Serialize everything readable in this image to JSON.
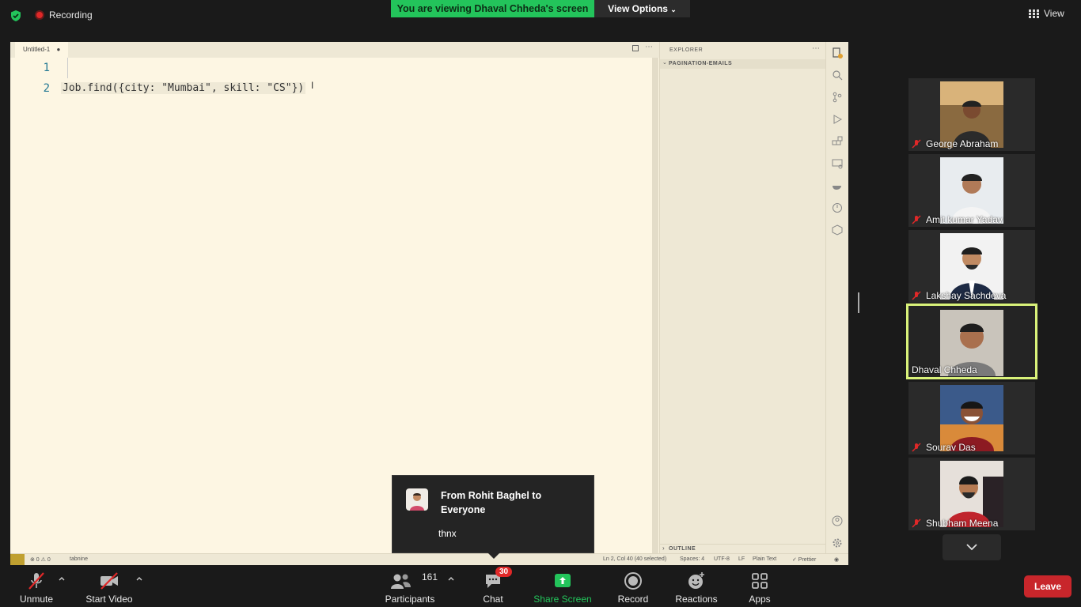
{
  "topbar": {
    "recording_label": "Recording",
    "viewing_banner": "You are viewing Dhaval Chheda's screen",
    "view_options_label": "View Options",
    "view_label": "View"
  },
  "shared_screen": {
    "tab_title": "Untitled-1",
    "line_numbers": [
      "1",
      "2"
    ],
    "code_line_2": "Job.find({city: \"Mumbai\", skill: \"CS\"})",
    "explorer_title": "EXPLORER",
    "folder_name": "PAGINATION-EMAILS",
    "outline_title": "OUTLINE",
    "status": {
      "errors": "⊗ 0 ⚠ 0",
      "tabnine": "tabnine",
      "position": "Ln 2, Col 40 (40 selected)",
      "spaces": "Spaces: 4",
      "encoding": "UTF-8",
      "eol": "LF",
      "language": "Plain Text",
      "formatter": "✓ Prettier"
    }
  },
  "chat_popup": {
    "from": "From Rohit Baghel to Everyone",
    "message": "thnx"
  },
  "participants_gallery": [
    {
      "name": "George Abraham",
      "muted": true
    },
    {
      "name": "Amit kumar Yadav",
      "muted": true
    },
    {
      "name": "Lakshay Sachdeva",
      "muted": true
    },
    {
      "name": "Dhaval Chheda",
      "muted": false,
      "active_speaker": true
    },
    {
      "name": "Sourav Das",
      "muted": true
    },
    {
      "name": "Shubham Meena",
      "muted": true
    }
  ],
  "toolbar": {
    "unmute_label": "Unmute",
    "start_video_label": "Start Video",
    "participants_label": "Participants",
    "participants_count": "161",
    "chat_label": "Chat",
    "chat_badge": "30",
    "share_screen_label": "Share Screen",
    "record_label": "Record",
    "reactions_label": "Reactions",
    "apps_label": "Apps",
    "leave_label": "Leave"
  },
  "colors": {
    "banner_green": "#23c45b",
    "share_green": "#23c45b",
    "leave_red": "#c8262b",
    "active_border": "#d9f27a",
    "editor_bg": "#fdf6e3"
  }
}
